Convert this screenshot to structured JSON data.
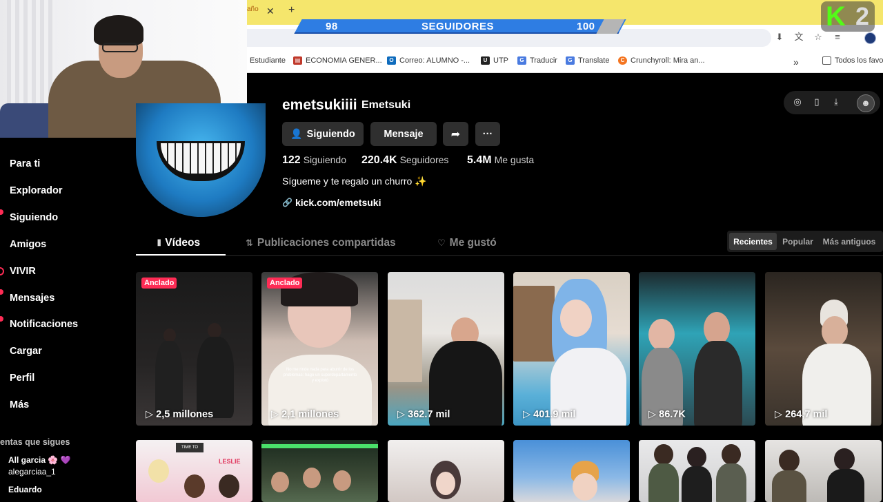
{
  "browser": {
    "tab_fragment": "año",
    "tab_close": "✕",
    "tab_new": "+",
    "bookmarks": [
      {
        "label": "Estudiante",
        "icon": "",
        "color": ""
      },
      {
        "label": "ECONOMIA GENER...",
        "icon": "book-icon",
        "color": "#c0392b"
      },
      {
        "label": "Correo: ALUMNO -...",
        "icon": "outlook-icon",
        "color": "#0f6cbd"
      },
      {
        "label": "UTP",
        "icon": "utp-icon",
        "color": "#222222"
      },
      {
        "label": "Traducir",
        "icon": "translate-icon",
        "color": "#4a7be0"
      },
      {
        "label": "Translate",
        "icon": "translate-icon",
        "color": "#4a7be0"
      },
      {
        "label": "Crunchyroll: Mira an...",
        "icon": "crunchyroll-icon",
        "color": "#f47521"
      }
    ],
    "bookmarks_more": "»",
    "all_bookmarks": "Todos los favo"
  },
  "overlay": {
    "followers_current": "98",
    "followers_label": "SEGUIDORES",
    "followers_goal": "100",
    "kick_letter": "K",
    "kick_number": "2"
  },
  "sidebar": {
    "items": [
      {
        "label": "Para ti",
        "dot": false
      },
      {
        "label": "Explorador",
        "dot": false
      },
      {
        "label": "Siguiendo",
        "dot": true
      },
      {
        "label": "Amigos",
        "dot": false
      },
      {
        "label": "VIVIR",
        "dot": false
      },
      {
        "label": "Mensajes",
        "dot": true
      },
      {
        "label": "Notificaciones",
        "dot": true
      },
      {
        "label": "Cargar",
        "dot": false
      },
      {
        "label": "Perfil",
        "dot": false
      },
      {
        "label": "Más",
        "dot": false
      }
    ],
    "following_title": "entas que sigues",
    "accounts": [
      {
        "name": "All garcia 🌸 💜",
        "handle": "alegarciaa_1"
      },
      {
        "name": "Eduardo",
        "handle": ""
      }
    ]
  },
  "profile": {
    "username": "emetsukiiii",
    "nickname": "Emetsuki",
    "follow_button": "Siguiendo",
    "message_button": "Mensaje",
    "more_button": "···",
    "stats": [
      {
        "value": "122",
        "label": "Siguiendo"
      },
      {
        "value": "220.4K",
        "label": "Seguidores"
      },
      {
        "value": "5.4M",
        "label": "Me gusta"
      }
    ],
    "bio": "Sígueme y te regalo un churro ✨",
    "link": "kick.com/emetsuki"
  },
  "tabs": [
    {
      "label": "Vídeos",
      "active": true
    },
    {
      "label": "Publicaciones compartidas",
      "active": false
    },
    {
      "label": "Me gustó",
      "active": false
    }
  ],
  "sort": [
    {
      "label": "Recientes",
      "active": true
    },
    {
      "label": "Popular",
      "active": false
    },
    {
      "label": "Más antiguos",
      "active": false
    }
  ],
  "videos": [
    {
      "pinned": "Anclado",
      "views": "2,5 millones",
      "caption": ""
    },
    {
      "pinned": "Anclado",
      "views": "2,1 millones",
      "caption": "No me rinde nada para aburrir de los problemas: hago un superdepartamento y explotó"
    },
    {
      "pinned": "",
      "views": "362.7 mil",
      "caption": ""
    },
    {
      "pinned": "",
      "views": "401.9 mil",
      "caption": ""
    },
    {
      "pinned": "",
      "views": "86.7K",
      "caption": ""
    },
    {
      "pinned": "",
      "views": "264,7 mil",
      "caption": ""
    }
  ],
  "row2_texts": {
    "sign_top": "TIME TO",
    "sign_name": "LESLIE"
  },
  "colors": {
    "accent": "#fe2c55",
    "kick_green": "#53fc18",
    "follower_bar": "#2e7de3",
    "tab_bar": "#f5e66c"
  }
}
